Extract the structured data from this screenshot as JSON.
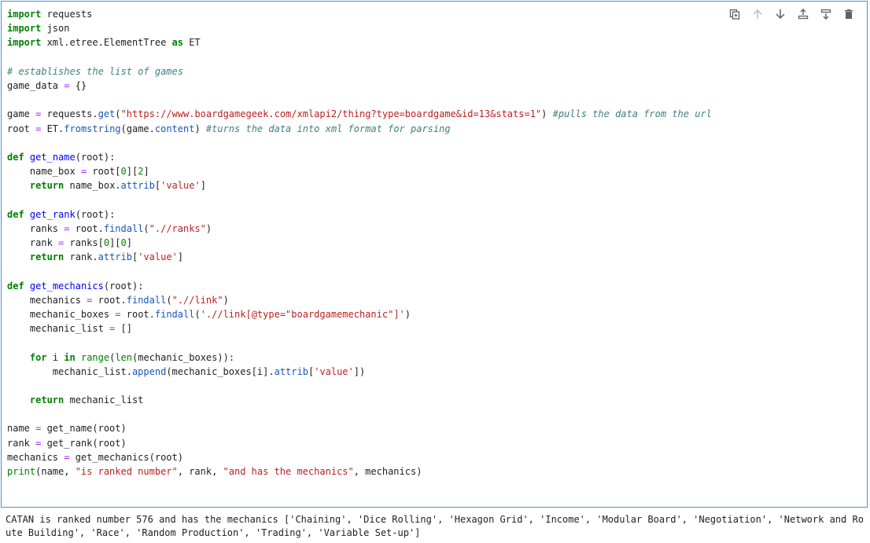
{
  "toolbar": {
    "buttons": [
      "duplicate",
      "move-up",
      "move-down",
      "insert-above",
      "insert-below",
      "delete"
    ]
  },
  "code": {
    "lines": [
      [
        [
          "kw",
          "import"
        ],
        [
          "t",
          " requests"
        ]
      ],
      [
        [
          "kw",
          "import"
        ],
        [
          "t",
          " json"
        ]
      ],
      [
        [
          "kw",
          "import"
        ],
        [
          "t",
          " xml.etree.ElementTree "
        ],
        [
          "kw",
          "as"
        ],
        [
          "t",
          " ET"
        ]
      ],
      [
        [
          "t",
          ""
        ]
      ],
      [
        [
          "cm",
          "# establishes the list of games"
        ]
      ],
      [
        [
          "t",
          "game_data "
        ],
        [
          "op",
          "="
        ],
        [
          "t",
          " "
        ],
        [
          "t",
          "{}"
        ]
      ],
      [
        [
          "t",
          ""
        ]
      ],
      [
        [
          "t",
          "game "
        ],
        [
          "op",
          "="
        ],
        [
          "t",
          " requests."
        ],
        [
          "at",
          "get"
        ],
        [
          "t",
          "("
        ],
        [
          "st",
          "\"https://www.boardgamegeek.com/xmlapi2/thing?type=boardgame&id=13&stats=1\""
        ],
        [
          "t",
          ") "
        ],
        [
          "cm",
          "#pulls the data from the url"
        ]
      ],
      [
        [
          "t",
          "root "
        ],
        [
          "op",
          "="
        ],
        [
          "t",
          " ET."
        ],
        [
          "at",
          "fromstring"
        ],
        [
          "t",
          "(game."
        ],
        [
          "at",
          "content"
        ],
        [
          "t",
          ") "
        ],
        [
          "cm",
          "#turns the data into xml format for parsing"
        ]
      ],
      [
        [
          "t",
          ""
        ]
      ],
      [
        [
          "kw",
          "def"
        ],
        [
          "t",
          " "
        ],
        [
          "fn",
          "get_name"
        ],
        [
          "t",
          "(root):"
        ]
      ],
      [
        [
          "t",
          "    name_box "
        ],
        [
          "op",
          "="
        ],
        [
          "t",
          " root["
        ],
        [
          "nu",
          "0"
        ],
        [
          "t",
          "]["
        ],
        [
          "nu",
          "2"
        ],
        [
          "t",
          "]"
        ]
      ],
      [
        [
          "t",
          "    "
        ],
        [
          "kw",
          "return"
        ],
        [
          "t",
          " name_box."
        ],
        [
          "at",
          "attrib"
        ],
        [
          "t",
          "["
        ],
        [
          "st",
          "'value'"
        ],
        [
          "t",
          "]"
        ]
      ],
      [
        [
          "t",
          ""
        ]
      ],
      [
        [
          "kw",
          "def"
        ],
        [
          "t",
          " "
        ],
        [
          "fn",
          "get_rank"
        ],
        [
          "t",
          "(root):"
        ]
      ],
      [
        [
          "t",
          "    ranks "
        ],
        [
          "op",
          "="
        ],
        [
          "t",
          " root."
        ],
        [
          "at",
          "findall"
        ],
        [
          "t",
          "("
        ],
        [
          "st",
          "\".//ranks\""
        ],
        [
          "t",
          ")"
        ]
      ],
      [
        [
          "t",
          "    rank "
        ],
        [
          "op",
          "="
        ],
        [
          "t",
          " ranks["
        ],
        [
          "nu",
          "0"
        ],
        [
          "t",
          "]["
        ],
        [
          "nu",
          "0"
        ],
        [
          "t",
          "]"
        ]
      ],
      [
        [
          "t",
          "    "
        ],
        [
          "kw",
          "return"
        ],
        [
          "t",
          " rank."
        ],
        [
          "at",
          "attrib"
        ],
        [
          "t",
          "["
        ],
        [
          "st",
          "'value'"
        ],
        [
          "t",
          "]"
        ]
      ],
      [
        [
          "t",
          ""
        ]
      ],
      [
        [
          "kw",
          "def"
        ],
        [
          "t",
          " "
        ],
        [
          "fn",
          "get_mechanics"
        ],
        [
          "t",
          "(root):"
        ]
      ],
      [
        [
          "t",
          "    mechanics "
        ],
        [
          "op",
          "="
        ],
        [
          "t",
          " root."
        ],
        [
          "at",
          "findall"
        ],
        [
          "t",
          "("
        ],
        [
          "st",
          "\".//link\""
        ],
        [
          "t",
          ")"
        ]
      ],
      [
        [
          "t",
          "    mechanic_boxes "
        ],
        [
          "op",
          "="
        ],
        [
          "t",
          " root."
        ],
        [
          "at",
          "findall"
        ],
        [
          "t",
          "("
        ],
        [
          "st",
          "'.//link[@type=\"boardgamemechanic\"]'"
        ],
        [
          "t",
          ")"
        ]
      ],
      [
        [
          "t",
          "    mechanic_list "
        ],
        [
          "op",
          "="
        ],
        [
          "t",
          " []"
        ]
      ],
      [
        [
          "t",
          ""
        ]
      ],
      [
        [
          "t",
          "    "
        ],
        [
          "kw",
          "for"
        ],
        [
          "t",
          " i "
        ],
        [
          "kw",
          "in"
        ],
        [
          "t",
          " "
        ],
        [
          "bi",
          "range"
        ],
        [
          "t",
          "("
        ],
        [
          "bi",
          "len"
        ],
        [
          "t",
          "(mechanic_boxes)):"
        ]
      ],
      [
        [
          "t",
          "        mechanic_list."
        ],
        [
          "at",
          "append"
        ],
        [
          "t",
          "(mechanic_boxes[i]."
        ],
        [
          "at",
          "attrib"
        ],
        [
          "t",
          "["
        ],
        [
          "st",
          "'value'"
        ],
        [
          "t",
          "])"
        ]
      ],
      [
        [
          "t",
          ""
        ]
      ],
      [
        [
          "t",
          "    "
        ],
        [
          "kw",
          "return"
        ],
        [
          "t",
          " mechanic_list"
        ]
      ],
      [
        [
          "t",
          ""
        ]
      ],
      [
        [
          "t",
          "name "
        ],
        [
          "op",
          "="
        ],
        [
          "t",
          " get_name(root)"
        ]
      ],
      [
        [
          "t",
          "rank "
        ],
        [
          "op",
          "="
        ],
        [
          "t",
          " get_rank(root)"
        ]
      ],
      [
        [
          "t",
          "mechanics "
        ],
        [
          "op",
          "="
        ],
        [
          "t",
          " get_mechanics(root)"
        ]
      ],
      [
        [
          "bi",
          "print"
        ],
        [
          "t",
          "(name, "
        ],
        [
          "st",
          "\"is ranked number\""
        ],
        [
          "t",
          ", rank, "
        ],
        [
          "st",
          "\"and has the mechanics\""
        ],
        [
          "t",
          ", mechanics)"
        ]
      ]
    ]
  },
  "output": {
    "text": "CATAN is ranked number 576 and has the mechanics ['Chaining', 'Dice Rolling', 'Hexagon Grid', 'Income', 'Modular Board', 'Negotiation', 'Network and Route Building', 'Race', 'Random Production', 'Trading', 'Variable Set-up']"
  }
}
